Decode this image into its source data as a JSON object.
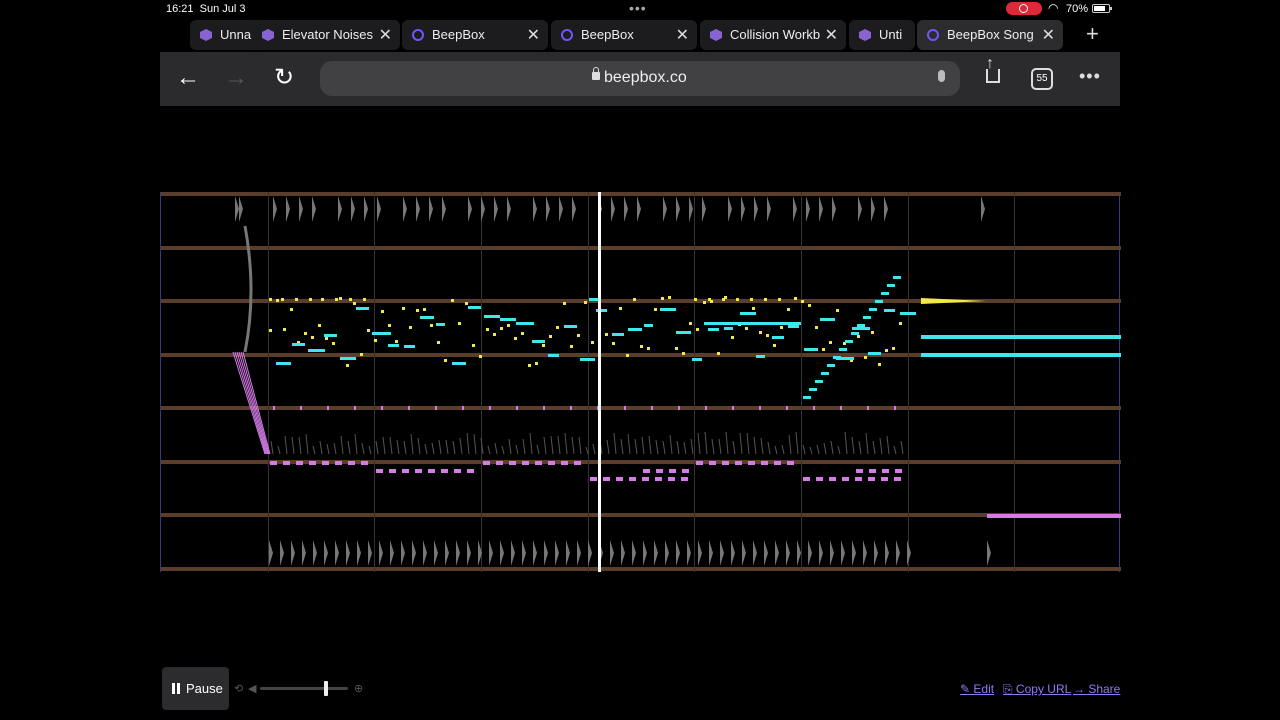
{
  "status_bar": {
    "time": "16:21",
    "date": "Sun Jul 3",
    "battery": "70%"
  },
  "tabs": [
    {
      "label": "Unna",
      "icon": "cube-icon",
      "active": false
    },
    {
      "label": "Elevator Noises",
      "icon": "cube-icon",
      "active": false
    },
    {
      "label": "BeepBox",
      "icon": "ring-icon",
      "active": false
    },
    {
      "label": "BeepBox",
      "icon": "ring-icon",
      "active": false
    },
    {
      "label": "Collision Workb",
      "icon": "cube-icon",
      "active": false
    },
    {
      "label": "Unti",
      "icon": "cube-icon",
      "active": false
    },
    {
      "label": "BeepBox Song",
      "icon": "ring-icon",
      "active": true
    }
  ],
  "toolbar": {
    "url": "beepbox.co",
    "tab_count": "55"
  },
  "player": {
    "pause_label": "Pause",
    "volume": 0.75,
    "links": {
      "edit": "✎ Edit",
      "copy": "⎘ Copy URL",
      "share": "→ Share"
    }
  },
  "colors": {
    "track_line": "#5a3e2b",
    "yellow": "#f2e84a",
    "cyan": "#3ee6f0",
    "pink": "#d57be8",
    "drum": "#777777",
    "playhead": "#ffffff",
    "link": "#8c7cf0"
  }
}
